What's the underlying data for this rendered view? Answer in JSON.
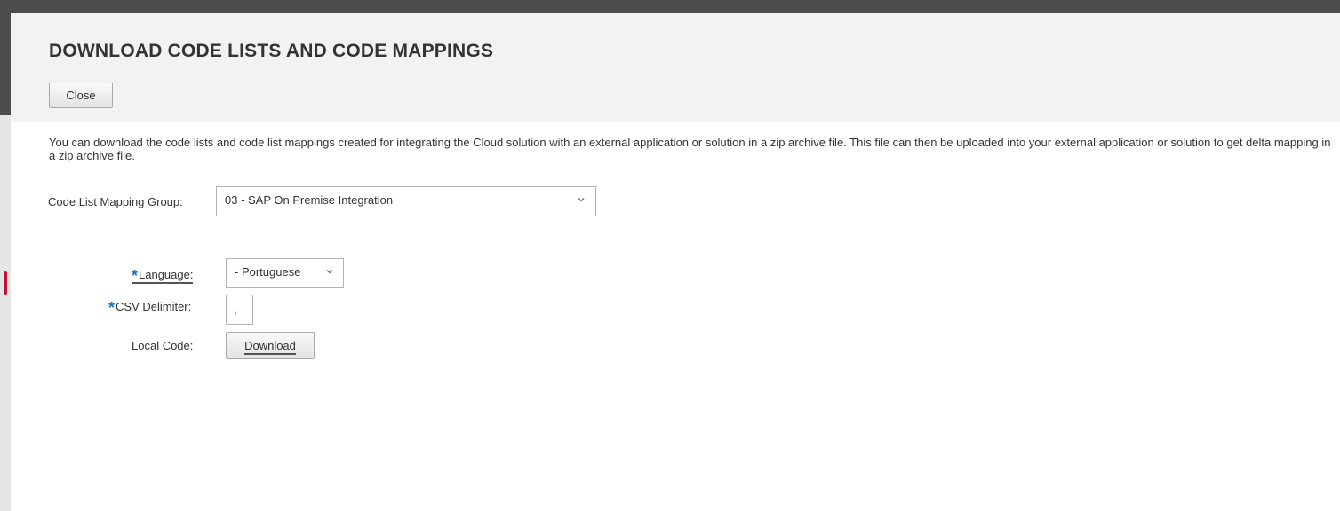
{
  "dialog": {
    "title": "DOWNLOAD CODE LISTS AND CODE MAPPINGS",
    "close_label": "Close"
  },
  "description": "You can download the code lists and code list mappings created for integrating the Cloud solution with an external application or solution in a zip archive file. This file can then be uploaded into your external application or solution to get delta mapping in a zip archive file.",
  "form": {
    "mapping_group": {
      "label": "Code List Mapping Group:",
      "value": "03 - SAP On Premise Integration",
      "icon": "chevron-down-icon"
    },
    "language": {
      "required_marker": "*",
      "label": "Language:",
      "value": "- Portuguese",
      "icon": "chevron-down-icon"
    },
    "csv_delimiter": {
      "required_marker": "*",
      "label": "CSV Delimiter:",
      "value": ","
    },
    "local_code": {
      "label": "Local Code:",
      "button_label": "Download"
    }
  },
  "colors": {
    "header_bg": "#f2f2f2",
    "top_bar": "#4d4d4d",
    "required_marker": "#1f6fb8",
    "text": "#333333"
  }
}
